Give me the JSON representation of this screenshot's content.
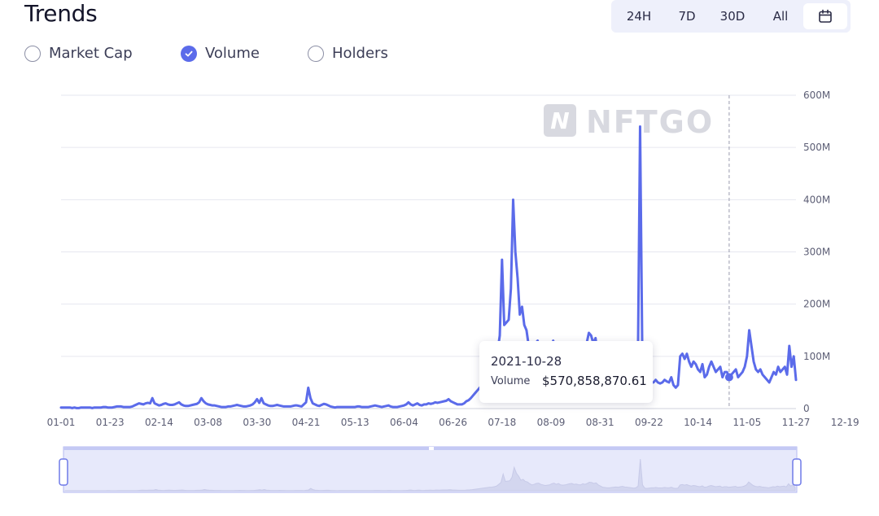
{
  "header": {
    "title": "Trends"
  },
  "time_range": {
    "buttons": [
      "24H",
      "7D",
      "30D",
      "All"
    ],
    "calendar_icon": "calendar-icon"
  },
  "metrics": [
    {
      "label": "Market Cap",
      "checked": false
    },
    {
      "label": "Volume",
      "checked": true
    },
    {
      "label": "Holders",
      "checked": false
    }
  ],
  "watermark": {
    "text": "NFTGO"
  },
  "tooltip": {
    "date": "2021-10-28",
    "label": "Volume",
    "value": "$570,858,870.61"
  },
  "colors": {
    "line": "#5b6bea",
    "accent": "#5b6bea",
    "grid": "#e6e7ef",
    "slider_fill": "#e7e9fb"
  },
  "chart_data": {
    "type": "line",
    "series": [
      {
        "name": "Volume",
        "values": [
          2,
          2,
          2,
          2,
          2,
          1,
          2,
          1,
          1,
          2,
          2,
          2,
          2,
          2,
          1,
          2,
          2,
          2,
          2,
          3,
          3,
          2,
          2,
          2,
          3,
          4,
          4,
          4,
          3,
          3,
          3,
          3,
          4,
          6,
          8,
          10,
          9,
          8,
          10,
          11,
          10,
          20,
          10,
          8,
          6,
          7,
          9,
          10,
          8,
          7,
          7,
          8,
          10,
          12,
          8,
          6,
          5,
          5,
          6,
          7,
          8,
          9,
          12,
          20,
          14,
          10,
          8,
          7,
          6,
          6,
          5,
          4,
          3,
          3,
          3,
          4,
          4,
          5,
          6,
          7,
          6,
          5,
          4,
          4,
          5,
          6,
          8,
          12,
          18,
          11,
          20,
          10,
          8,
          6,
          5,
          5,
          6,
          7,
          6,
          5,
          4,
          4,
          4,
          4,
          5,
          6,
          6,
          5,
          4,
          8,
          12,
          40,
          20,
          10,
          8,
          6,
          5,
          7,
          9,
          8,
          6,
          4,
          3,
          2,
          3,
          3,
          3,
          3,
          3,
          3,
          3,
          3,
          3,
          4,
          4,
          3,
          3,
          3,
          3,
          4,
          5,
          6,
          5,
          4,
          3,
          4,
          5,
          6,
          4,
          3,
          3,
          3,
          4,
          5,
          6,
          8,
          12,
          8,
          6,
          8,
          10,
          7,
          6,
          8,
          8,
          10,
          9,
          10,
          12,
          11,
          12,
          13,
          14,
          15,
          18,
          14,
          12,
          10,
          8,
          8,
          8,
          10,
          14,
          16,
          20,
          25,
          30,
          35,
          40,
          45,
          50,
          55,
          60,
          62,
          70,
          80,
          110,
          140,
          285,
          160,
          165,
          170,
          230,
          400,
          300,
          250,
          180,
          195,
          160,
          150,
          120,
          100,
          110,
          125,
          130,
          110,
          100,
          90,
          95,
          100,
          120,
          130,
          110,
          125,
          100,
          95,
          100,
          110,
          120,
          125,
          110,
          115,
          105,
          100,
          120,
          110,
          125,
          145,
          140,
          125,
          135,
          100,
          80,
          60,
          55,
          50,
          50,
          55,
          60,
          65,
          60,
          70,
          75,
          65,
          60,
          55,
          50,
          45,
          50,
          80,
          540,
          100,
          45,
          40,
          45,
          50,
          50,
          55,
          50,
          48,
          50,
          55,
          52,
          50,
          60,
          45,
          40,
          45,
          100,
          105,
          95,
          105,
          90,
          80,
          90,
          85,
          75,
          70,
          85,
          60,
          65,
          80,
          90,
          80,
          70,
          75,
          80,
          60,
          70,
          70,
          60,
          65,
          70,
          75,
          60,
          65,
          70,
          80,
          100,
          150,
          120,
          90,
          75,
          70,
          75,
          65,
          60,
          55,
          50,
          60,
          70,
          65,
          80,
          70,
          75,
          80,
          65,
          120,
          80,
          100,
          55
        ]
      }
    ],
    "tooltip_index": 300,
    "x_tick_labels": [
      "01-01",
      "01-23",
      "02-14",
      "03-08",
      "03-30",
      "04-21",
      "05-13",
      "06-04",
      "06-26",
      "07-18",
      "08-09",
      "08-31",
      "09-22",
      "10-14",
      "11-05",
      "11-27",
      "12-19"
    ],
    "y_tick_labels": [
      "0",
      "100M",
      "200M",
      "300M",
      "400M",
      "500M",
      "600M"
    ],
    "xlabel": "",
    "ylabel": "",
    "ylim": [
      0,
      600
    ],
    "y_unit": "M",
    "grid": true,
    "legend": "none"
  }
}
